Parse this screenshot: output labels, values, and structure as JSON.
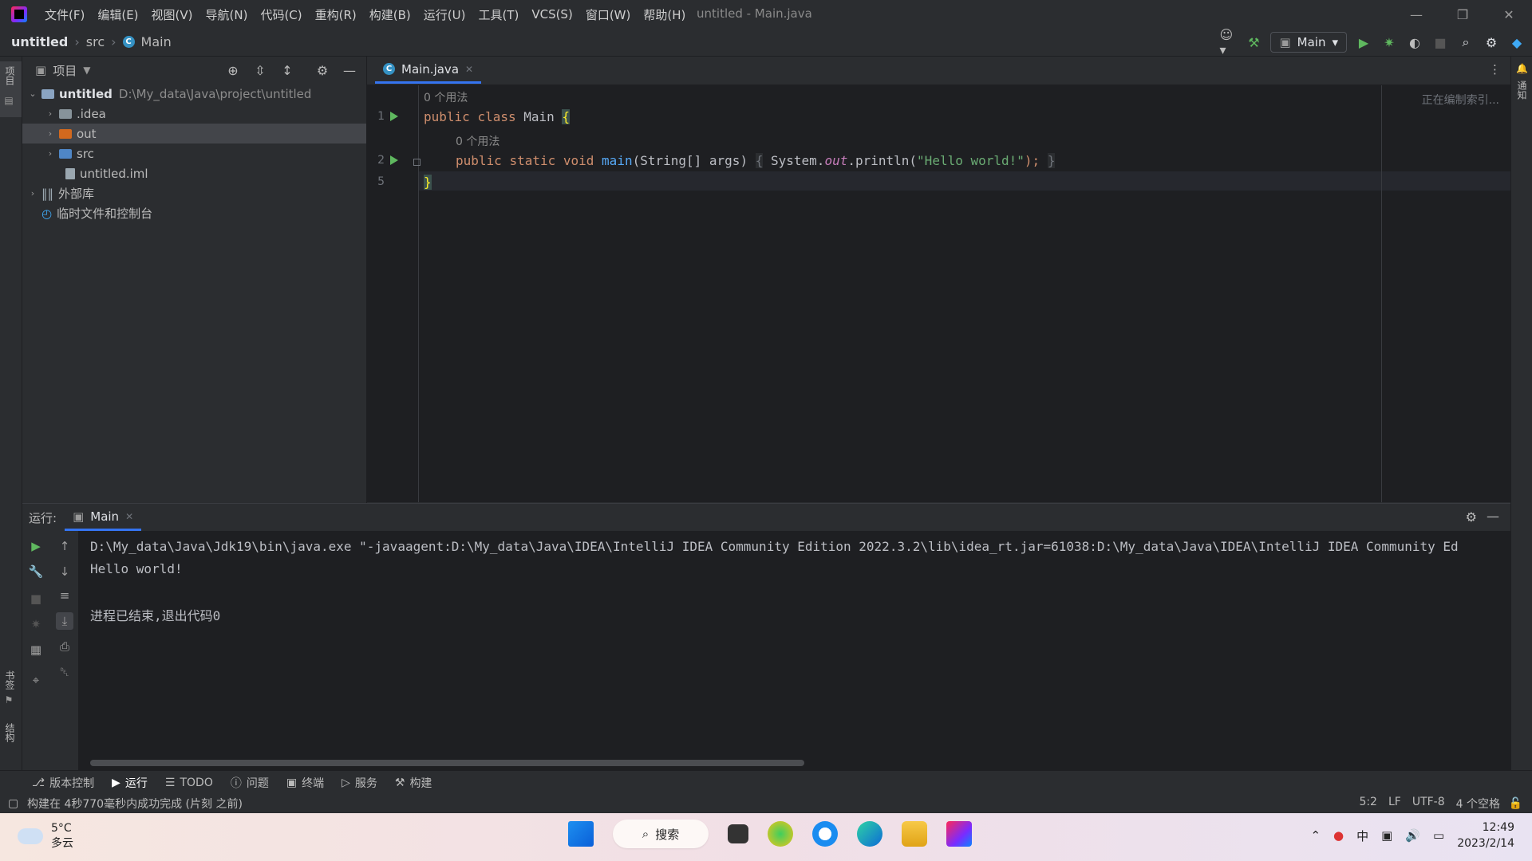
{
  "titlebar": {
    "menus": [
      "文件(F)",
      "编辑(E)",
      "视图(V)",
      "导航(N)",
      "代码(C)",
      "重构(R)",
      "构建(B)",
      "运行(U)",
      "工具(T)",
      "VCS(S)",
      "窗口(W)",
      "帮助(H)"
    ],
    "window_title": "untitled - Main.java"
  },
  "navbar": {
    "crumbs": [
      "untitled",
      "src",
      "Main"
    ],
    "run_config": "Main"
  },
  "left_stripe": {
    "project_tab": "项目",
    "bookmarks_tab": "书签",
    "structure_tab": "结构"
  },
  "right_stripe": {
    "notifications_tab": "通知"
  },
  "project": {
    "title": "项目",
    "tree": [
      {
        "label": "untitled",
        "path": "D:\\My_data\\Java\\project\\untitled"
      },
      {
        "label": ".idea"
      },
      {
        "label": "out"
      },
      {
        "label": "src"
      },
      {
        "label": "untitled.iml"
      },
      {
        "label": "外部库"
      },
      {
        "label": "临时文件和控制台"
      }
    ]
  },
  "editor": {
    "tab_label": "Main.java",
    "indexing": "正在编制索引...",
    "usage_hint_1": "0 个用法",
    "usage_hint_2": "0 个用法",
    "line_numbers": [
      "1",
      "2",
      "5"
    ],
    "line1": {
      "kw1": "public",
      "kw2": "class",
      "name": "Main",
      "brace": "{"
    },
    "line2": {
      "kw1": "public",
      "kw2": "static",
      "kw3": "void",
      "fn": "main",
      "params": "(String[] args)",
      "open": "{",
      "obj": "System.",
      "field": "out",
      "call": ".println(",
      "str": "\"Hello world!\"",
      "close_stmt": ");",
      "close": "}"
    },
    "line5": {
      "brace": "}"
    }
  },
  "run": {
    "label": "运行:",
    "tab": "Main",
    "console": [
      "D:\\My_data\\Java\\Jdk19\\bin\\java.exe \"-javaagent:D:\\My_data\\Java\\IDEA\\IntelliJ IDEA Community Edition 2022.3.2\\lib\\idea_rt.jar=61038:D:\\My_data\\Java\\IDEA\\IntelliJ IDEA Community Ed",
      "Hello world!",
      "",
      "进程已结束,退出代码0"
    ]
  },
  "toolstrip": [
    "版本控制",
    "运行",
    "TODO",
    "问题",
    "终端",
    "服务",
    "构建"
  ],
  "status": {
    "message": "构建在 4秒770毫秒内成功完成 (片刻 之前)",
    "position": "5:2",
    "line_sep": "LF",
    "encoding": "UTF-8",
    "indent": "4 个空格"
  },
  "taskbar": {
    "temp": "5°C",
    "weather": "多云",
    "search": "搜索",
    "ime": "中",
    "time": "12:49",
    "date": "2023/2/14"
  }
}
